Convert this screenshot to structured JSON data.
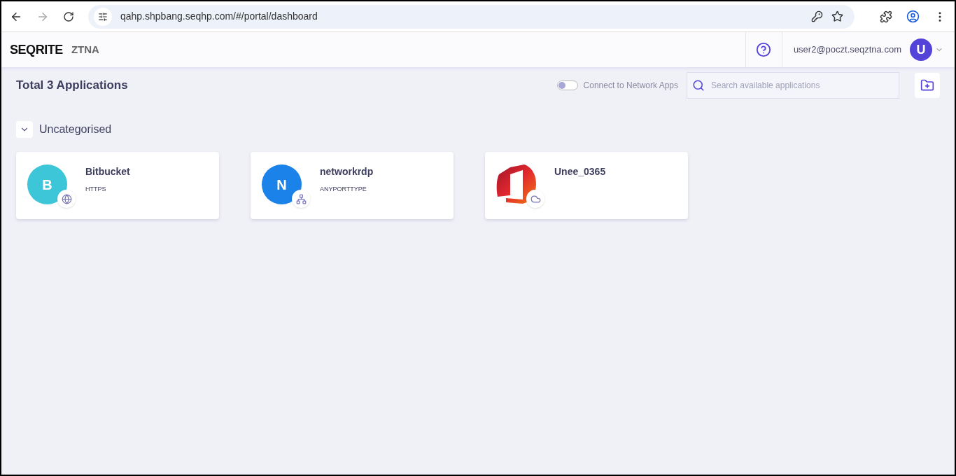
{
  "browser": {
    "url": "qahp.shpbang.seqhp.com/#/portal/dashboard"
  },
  "header": {
    "brand": "SEQRITE",
    "product": "ZTNA",
    "user_email": "user2@poczt.seqztna.com",
    "avatar_letter": "U"
  },
  "toolbar": {
    "title": "Total 3 Applications",
    "toggle": {
      "label": "Connect to Network Apps",
      "on": false
    },
    "search": {
      "placeholder": "Search available applications"
    }
  },
  "category": {
    "name": "Uncategorised",
    "expanded": true,
    "apps": [
      {
        "name": "Bitbucket",
        "type": "HTTPS",
        "kind": "letter",
        "letter": "B",
        "color": "#3cc6d8",
        "badge": {
          "kind": "web"
        }
      },
      {
        "name": "networkrdp",
        "type": "ANYPORTTYPE",
        "kind": "letter",
        "letter": "N",
        "color": "#1a82e8",
        "badge": {
          "kind": "network"
        }
      },
      {
        "name": "Unee_0365",
        "kind": "logo",
        "badge": {
          "kind": "cloud"
        }
      }
    ]
  }
}
